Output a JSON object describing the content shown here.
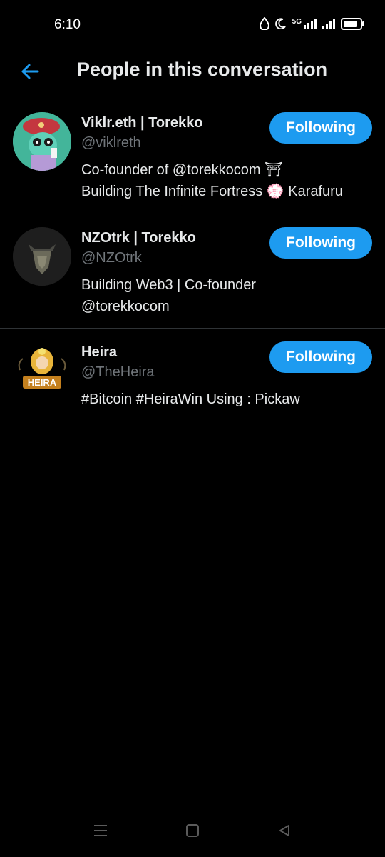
{
  "status_bar": {
    "time": "6:10",
    "network": "5G",
    "icons": [
      "water-drop-icon",
      "moon-icon",
      "signal-5g-icon",
      "signal-icon",
      "battery-icon"
    ],
    "battery_level": 0.85
  },
  "header": {
    "title": "People in this conversation",
    "back_icon": "arrow-left-icon"
  },
  "people": [
    {
      "name": "Viklr.eth | Torekko",
      "handle": "@viklreth",
      "bio_line1": "Co-founder of @torekkocom ⛩",
      "bio_line2": "Building The Infinite Fortress 💮 Karafuru",
      "button": "Following"
    },
    {
      "name": "NZOtrk | Torekko",
      "handle": "@NZOtrk",
      "bio_line1": "Building Web3 | Co-founder",
      "bio_line2": "@torekkocom",
      "button": "Following"
    },
    {
      "name": "Heira",
      "handle": "@TheHeira",
      "bio_line1": "#Bitcoin #HeiraWin Using : Pickaw",
      "button": "Following",
      "avatar_text": "HEIRA"
    }
  ],
  "nav_bar": {
    "icons": [
      "menu-icon",
      "home-square-icon",
      "back-triangle-icon"
    ]
  },
  "colors": {
    "background": "#000000",
    "accent": "#1d9bf0",
    "text_primary": "#e7e9ea",
    "text_secondary": "#71767b",
    "divider": "#2f3336"
  }
}
